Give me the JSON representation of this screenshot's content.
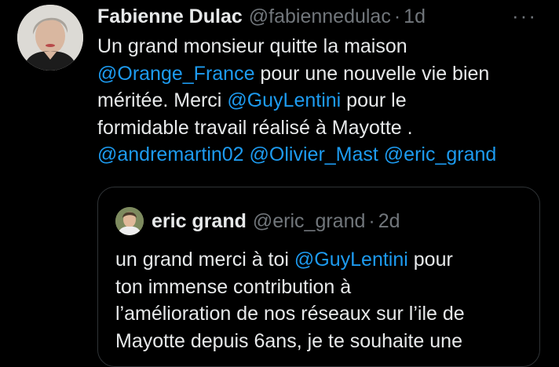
{
  "tweet": {
    "display_name": "Fabienne Dulac",
    "handle": "@fabiennedulac",
    "separator": "·",
    "time": "1d",
    "more_label": "···",
    "text": {
      "l1": "Un grand monsieur quitte la maison",
      "l2_mention": "@Orange_France",
      "l2_text": " pour une nouvelle vie bien",
      "l3_text": "méritée. Merci ",
      "l3_mention": "@GuyLentini",
      "l3_tail": " pour le",
      "l4": "formidable travail réalisé à Mayotte .",
      "l5_m1": "@andremartin02",
      "l5_m2": "@Olivier_Mast",
      "l5_m3": "@eric_grand"
    }
  },
  "quoted": {
    "display_name": "eric grand",
    "handle": "@eric_grand",
    "separator": "·",
    "time": "2d",
    "text": {
      "l1_text": "un grand merci à toi ",
      "l1_mention": "@GuyLentini",
      "l1_tail": " pour",
      "l2": "ton immense contribution à",
      "l3": "l’amélioration de nos réseaux sur l’ile de",
      "l4": "Mayotte depuis 6ans, je te souhaite une"
    }
  },
  "colors": {
    "background": "#000000",
    "text": "#e7e9ea",
    "secondary": "#71767b",
    "link": "#1d9bf0",
    "border": "#2f3336"
  },
  "icons": {
    "author_avatar": "avatar-photo",
    "quoted_avatar": "avatar-photo",
    "more": "more-horizontal-icon"
  }
}
